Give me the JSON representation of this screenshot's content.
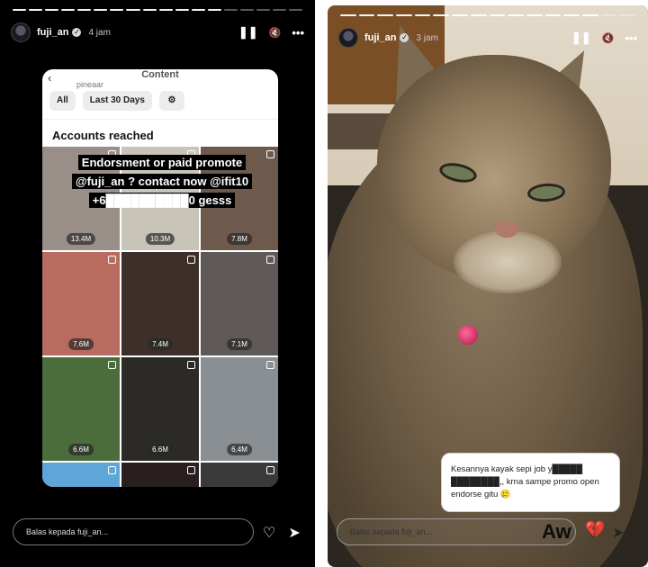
{
  "left_story": {
    "username": "fuji_an",
    "time": "4 jam",
    "controls": {
      "pause": "❚❚",
      "mute": "🔇",
      "more": "•••"
    },
    "card": {
      "title": "Content",
      "handle": "pineaar",
      "filters": [
        "All",
        "Last 30 Days"
      ],
      "filter_icon": "⚙",
      "section_title": "Accounts reached",
      "tiles": [
        {
          "count": "13.4M",
          "color": "#9a8f88"
        },
        {
          "count": "10.3M",
          "color": "#c9c4b8"
        },
        {
          "count": "7.8M",
          "color": "#6d5a4d"
        },
        {
          "count": "7.6M",
          "color": "#b86b5e"
        },
        {
          "count": "7.4M",
          "color": "#3d2f2a"
        },
        {
          "count": "7.1M",
          "color": "#5f5a57"
        },
        {
          "count": "6.6M",
          "color": "#4a6d3b"
        },
        {
          "count": "6.6M",
          "color": "#2b2a26"
        },
        {
          "count": "6.4M",
          "color": "#8a8f94"
        },
        {
          "count": "",
          "color": "#5fa6d8"
        },
        {
          "count": "",
          "color": "#2a1f1f"
        },
        {
          "count": "",
          "color": "#3a3a3a"
        }
      ]
    },
    "overlay": "Endorsment or paid promote @fuji_an ? contact now @ifit10 +6██████████0 gesss",
    "reply_placeholder": "Balas kepada fuji_an...",
    "actions": {
      "like": "♡",
      "share": "➤"
    }
  },
  "right_story": {
    "username": "fuji_an",
    "time": "3 jam",
    "controls": {
      "pause": "❚❚",
      "mute": "🔇",
      "more": "•••"
    },
    "comment": "Kesannya kayak sepi job y█████ ████████,, krna sampe promo open endorse gitu 🥲",
    "reaction_text": "Aw",
    "reaction_emoji": "💔",
    "reply_placeholder": "Balas kepada fuji_an...",
    "actions": {
      "like": "♡",
      "share": "➤"
    }
  }
}
